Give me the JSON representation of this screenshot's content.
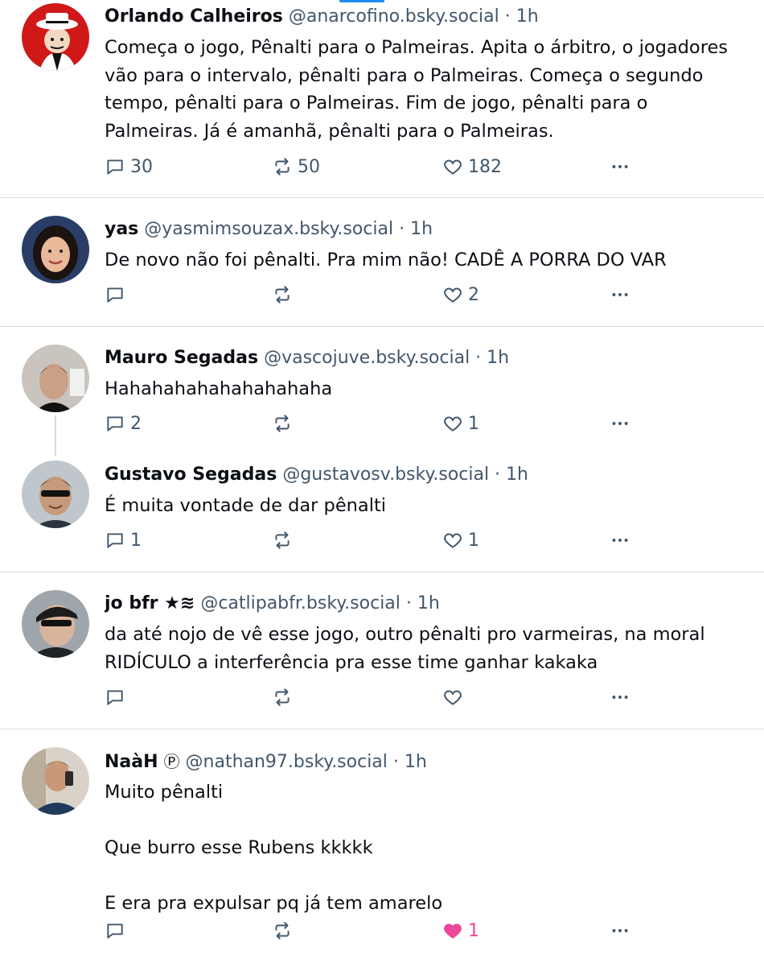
{
  "colors": {
    "text": "#0b0f14",
    "muted": "#42576c",
    "divider": "#d9dee3",
    "like_active": "#ec4899",
    "accent": "#1d8cf0"
  },
  "icons": {
    "reply": "reply-icon",
    "repost": "repost-icon",
    "like": "heart-icon",
    "more": "more-options-icon"
  },
  "posts": [
    {
      "author": "Orlando Calheiros",
      "handle": "@anarcofino.bsky.social",
      "sep": " · ",
      "time": "1h",
      "text": "Começa o jogo, Pênalti para o Palmeiras. Apita o árbitro, o jogadores\nvão para o intervalo, pênalti para o Palmeiras. Começa o segundo\ntempo, pênalti para o Palmeiras. Fim de jogo, pênalti para o\nPalmeiras. Já é amanhã, pênalti para o Palmeiras.",
      "replies": "30",
      "reposts": "50",
      "likes": "182"
    },
    {
      "author": "yas",
      "handle": "@yasmimsouzax.bsky.social",
      "sep": " · ",
      "time": "1h",
      "text": "De novo não foi pênalti. Pra mim não! CADÊ A PORRA DO VAR",
      "replies": "",
      "reposts": "",
      "likes": "2"
    },
    {
      "author": "Mauro Segadas",
      "handle": "@vascojuve.bsky.social",
      "sep": " · ",
      "time": "1h",
      "text": "Hahahahahahahahahaha",
      "replies": "2",
      "reposts": "",
      "likes": "1"
    },
    {
      "author": "Gustavo Segadas",
      "handle": "@gustavosv.bsky.social",
      "sep": " · ",
      "time": "1h",
      "text": "É muita vontade de dar pênalti",
      "replies": "1",
      "reposts": "",
      "likes": "1"
    },
    {
      "author": "jo bfr ★≋",
      "handle": "@catlipabfr.bsky.social",
      "sep": " · ",
      "time": "1h",
      "text": "da até nojo de vê esse jogo, outro pênalti pro varmeiras, na moral\nRIDÍCULO a interferência pra esse time ganhar kakaka",
      "replies": "",
      "reposts": "",
      "likes": ""
    },
    {
      "author": "NaàH",
      "badge": "Ⓟ",
      "handle": "@nathan97.bsky.social",
      "sep": " · ",
      "time": "1h",
      "text": "Muito pênalti\n\nQue burro esse Rubens kkkkk\n\nE era pra expulsar pq já tem amarelo",
      "replies": "",
      "reposts": "",
      "likes": "1",
      "liked": true
    }
  ]
}
